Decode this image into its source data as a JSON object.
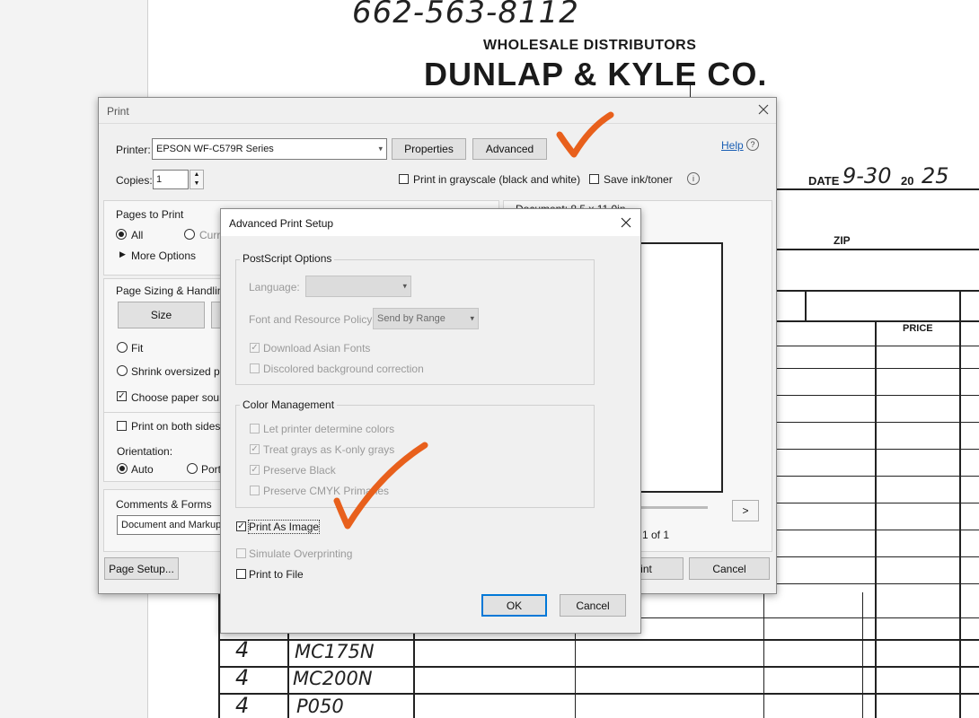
{
  "background": {
    "phone": "662-563-8112",
    "wholesale": "WHOLESALE DISTRIBUTORS",
    "company": "DUNLAP & KYLE CO.",
    "date_label": "DATE",
    "date_hand": "9-30",
    "year_prefix": "20",
    "year_hand": "25",
    "zip_label": "ZIP",
    "price_label": "PRICE",
    "rows": [
      {
        "qty": "4",
        "item": "MC175N"
      },
      {
        "qty": "4",
        "item": "MC200N"
      },
      {
        "qty": "4",
        "item": "P050"
      }
    ],
    "mark_color": "#e8601c"
  },
  "print_dialog": {
    "title": "Print",
    "printer_label": "Printer:",
    "printer_value": "EPSON WF-C579R Series",
    "properties_label": "Properties",
    "advanced_label": "Advanced",
    "help_label": "Help",
    "copies_label": "Copies:",
    "copies_value": "1",
    "grayscale_label": "Print in grayscale (black and white)",
    "save_ink_label": "Save ink/toner",
    "pages_header": "Pages to Print",
    "all_label": "All",
    "current_label": "Curre",
    "more_options_label": "More Options",
    "sizing_header": "Page Sizing & Handling",
    "size_label": "Size",
    "fit_label": "Fit",
    "shrink_label": "Shrink oversized pag",
    "choose_source_label": "Choose paper source",
    "both_sides_label": "Print on both sides o",
    "orientation_label": "Orientation:",
    "auto_label": "Auto",
    "portrait_label": "Portr",
    "comments_header": "Comments & Forms",
    "comments_value": "Document and Markup",
    "document_label": "Document: 8.5 x 11.0in",
    "page_count": "1 of 1",
    "next_label": ">",
    "page_setup_label": "Page Setup...",
    "print_label": "Print",
    "cancel_label": "Cancel"
  },
  "advanced_dialog": {
    "title": "Advanced Print Setup",
    "postscript_header": "PostScript Options",
    "language_label": "Language:",
    "font_policy_label": "Font and Resource Policy:",
    "font_policy_value": "Send by Range",
    "download_asian_label": "Download Asian Fonts",
    "discolored_label": "Discolored background correction",
    "color_header": "Color Management",
    "let_printer_label": "Let printer determine colors",
    "treat_grays_label": "Treat grays as K-only grays",
    "preserve_black_label": "Preserve Black",
    "preserve_cmyk_label": "Preserve CMYK Primaries",
    "print_as_image_label": "Print As Image",
    "simulate_label": "Simulate Overprinting",
    "print_to_file_label": "Print to File",
    "ok_label": "OK",
    "cancel_label": "Cancel"
  }
}
